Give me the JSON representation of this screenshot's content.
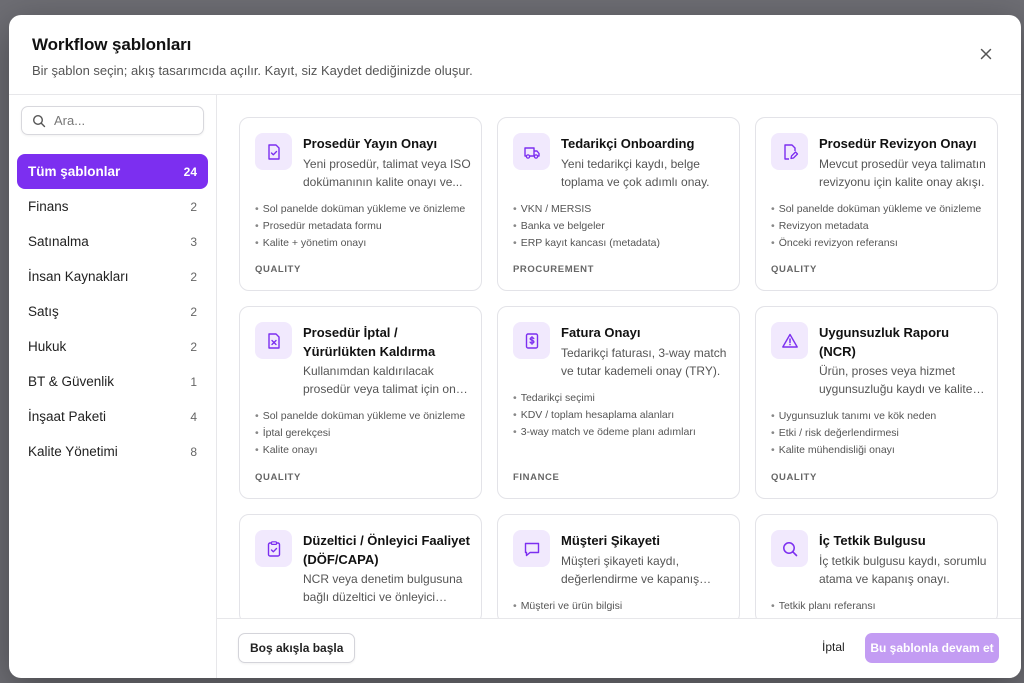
{
  "dialog": {
    "title": "Workflow şablonları",
    "subtitle": "Bir şablon seçin; akış tasarımcıda açılır. Kayıt, siz Kaydet dediğinizde oluşur.",
    "close_icon": "close-icon"
  },
  "search": {
    "placeholder": "Ara..."
  },
  "categories": [
    {
      "label": "Tüm şablonlar",
      "count": "24",
      "active": true
    },
    {
      "label": "Finans",
      "count": "2"
    },
    {
      "label": "Satınalma",
      "count": "3"
    },
    {
      "label": "İnsan Kaynakları",
      "count": "2"
    },
    {
      "label": "Satış",
      "count": "2"
    },
    {
      "label": "Hukuk",
      "count": "2"
    },
    {
      "label": "BT & Güvenlik",
      "count": "1"
    },
    {
      "label": "İnşaat Paketi",
      "count": "4"
    },
    {
      "label": "Kalite Yönetimi",
      "count": "8"
    }
  ],
  "templates": [
    {
      "title": "Prosedür Yayın Onayı",
      "description": "Yeni prosedür, talimat veya ISO dokümanının kalite onayı ve...",
      "items": [
        "Sol panelde doküman yükleme ve önizleme",
        "Prosedür metadata formu",
        "Kalite + yönetim onayı"
      ],
      "tag": "QUALITY",
      "icon": "document-check-icon"
    },
    {
      "title": "Tedarikçi Onboarding",
      "description": "Yeni tedarikçi kaydı, belge toplama ve çok adımlı onay.",
      "items": [
        "VKN / MERSIS",
        "Banka ve belgeler",
        "ERP kayıt kancası (metadata)"
      ],
      "tag": "PROCUREMENT",
      "icon": "truck-icon"
    },
    {
      "title": "Prosedür Revizyon Onayı",
      "description": "Mevcut prosedür veya talimatın revizyonu için kalite onay akışı.",
      "items": [
        "Sol panelde doküman yükleme ve önizleme",
        "Revizyon metadata",
        "Önceki revizyon referansı"
      ],
      "tag": "QUALITY",
      "icon": "document-edit-icon"
    },
    {
      "title": "Prosedür İptal / Yürürlükten Kaldırma",
      "description": "Kullanımdan kaldırılacak prosedür veya talimat için onay akışı.",
      "items": [
        "Sol panelde doküman yükleme ve önizleme",
        "İptal gerekçesi",
        "Kalite onayı"
      ],
      "tag": "QUALITY",
      "icon": "document-x-icon"
    },
    {
      "title": "Fatura Onayı",
      "description": "Tedarikçi faturası, 3-way match ve tutar kademeli onay (TRY).",
      "items": [
        "Tedarikçi seçimi",
        "KDV / toplam hesaplama alanları",
        "3-way match ve ödeme planı adımları"
      ],
      "tag": "FINANCE",
      "icon": "invoice-dollar-icon"
    },
    {
      "title": "Uygunsuzluk Raporu (NCR)",
      "description": "Ürün, proses veya hizmet uygunsuzluğu kaydı ve kalite incelemesi.",
      "items": [
        "Uygunsuzluk tanımı ve kök neden",
        "Etki / risk değerlendirmesi",
        "Kalite mühendisliği onayı"
      ],
      "tag": "QUALITY",
      "icon": "warning-triangle-icon"
    },
    {
      "title": "Düzeltici / Önleyici Faaliyet (DÖF/CAPA)",
      "description": "NCR veya denetim bulgusuna bağlı düzeltici ve önleyici faaliyet.",
      "items": [],
      "tag": "",
      "icon": "clipboard-check-icon"
    },
    {
      "title": "Müşteri Şikayeti",
      "description": "Müşteri şikayeti kaydı, değerlendirme ve kapanış akışı.",
      "items": [
        "Müşteri ve ürün bilgisi"
      ],
      "tag": "",
      "icon": "chat-bubble-icon"
    },
    {
      "title": "İç Tetkik Bulgusu",
      "description": "İç tetkik bulgusu kaydı, sorumlu atama ve kapanış onayı.",
      "items": [
        "Tetkik planı referansı"
      ],
      "tag": "",
      "icon": "magnifier-icon"
    }
  ],
  "footer": {
    "blank_flow": "Boş akışla başla",
    "cancel": "İptal",
    "continue": "Bu şablonla devam et"
  },
  "colors": {
    "accent": "#7c2ff0",
    "accent_light": "#f1e9fd",
    "primary_disabled": "#c39cf3"
  }
}
